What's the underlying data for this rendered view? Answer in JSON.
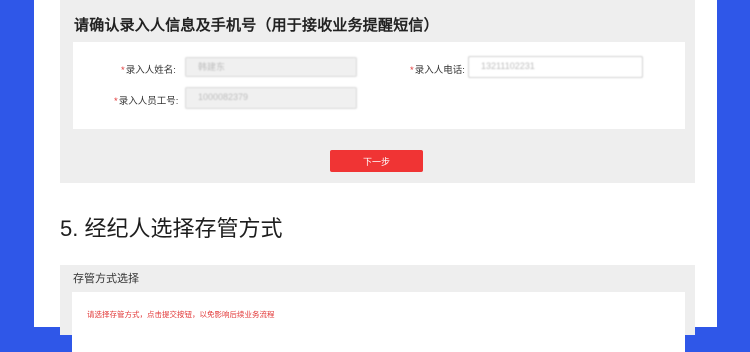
{
  "confirm_section": {
    "title": "请确认录入人信息及手机号（用于接收业务提醒短信）",
    "name_label": "录入人姓名:",
    "name_value": "韩建东",
    "phone_label": "录入人电话:",
    "phone_value": "13211102231",
    "empno_label": "录入人员工号:",
    "empno_value": "1000082379",
    "required_mark": "*",
    "next_button": "下一步"
  },
  "step": {
    "title": "5. 经纪人选择存管方式"
  },
  "custody_section": {
    "title": "存管方式选择",
    "warning": "请选择存管方式，点击提交按钮，以免影响后续业务流程"
  },
  "colors": {
    "background_blue": "#2f57e8",
    "accent_red": "#f03434",
    "panel_gray": "#eeeeee"
  }
}
